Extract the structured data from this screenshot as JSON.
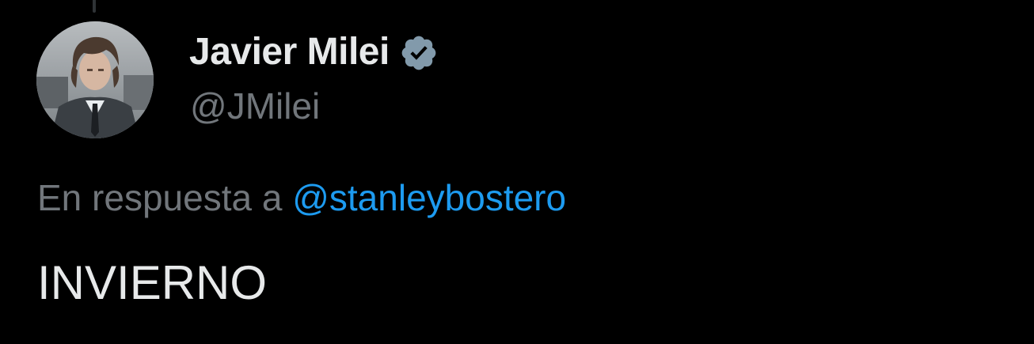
{
  "tweet": {
    "author": {
      "display_name": "Javier Milei",
      "handle": "@JMilei",
      "verified": true,
      "verified_badge_color": "#829aab"
    },
    "reply": {
      "prefix": "En respuesta a",
      "mention": "@stanleybostero"
    },
    "text": "INVIERNO"
  },
  "colors": {
    "background": "#000000",
    "primary_text": "#e7e9ea",
    "secondary_text": "#71767b",
    "link": "#1d9bf0"
  }
}
